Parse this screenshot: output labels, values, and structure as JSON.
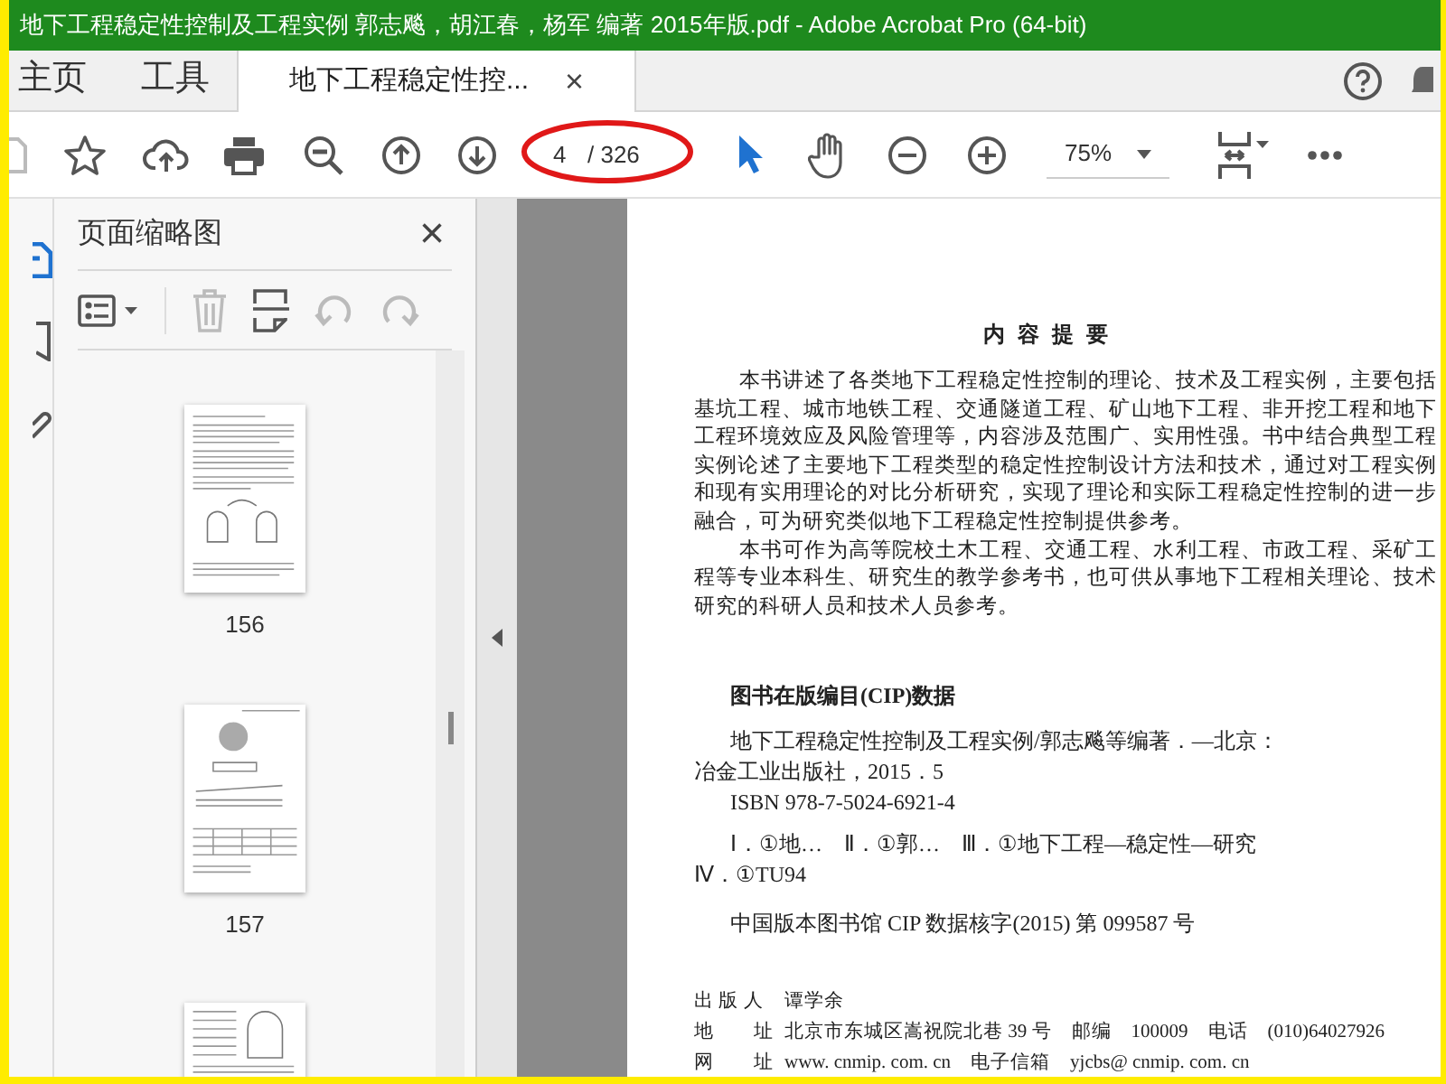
{
  "window": {
    "title": "地下工程稳定性控制及工程实例 郭志飚，胡江春，杨军 编著 2015年版.pdf - Adobe Acrobat Pro (64-bit)"
  },
  "tabs": [
    {
      "label": "主页",
      "selected": false
    },
    {
      "label": "工具",
      "selected": false
    },
    {
      "label": "地下工程稳定性控...",
      "selected": true,
      "close": "×"
    }
  ],
  "toolbar": {
    "page_value": "4",
    "page_total": "/ 326",
    "zoom": "75%"
  },
  "sidebar": {
    "title": "页面缩略图",
    "close": "×",
    "thumbnails": [
      {
        "label": "156",
        "kind": "text"
      },
      {
        "label": "157",
        "kind": "figure"
      },
      {
        "kind": "arch"
      }
    ]
  },
  "document": {
    "heading": "内 容 提 要",
    "summary": [
      {
        "text": "本书讲述了各类地下工程稳定性控制的理论、技术及工程实例，主要包括",
        "kind": "first"
      },
      {
        "text": "基坑工程、城市地铁工程、交通隧道工程、矿山地下工程、非开挖工程和地下",
        "kind": "full"
      },
      {
        "text": "工程环境效应及风险管理等，内容涉及范围广、实用性强。书中结合典型工程",
        "kind": "full"
      },
      {
        "text": "实例论述了主要地下工程类型的稳定性控制设计方法和技术，通过对工程实例",
        "kind": "full"
      },
      {
        "text": "和现有实用理论的对比分析研究，实现了理论和实际工程稳定性控制的进一步",
        "kind": "full"
      },
      {
        "text": "融合，可为研究类似地下工程稳定性控制提供参考。",
        "kind": "last"
      },
      {
        "text": "本书可作为高等院校土木工程、交通工程、水利工程、市政工程、采矿工",
        "kind": "first"
      },
      {
        "text": "程等专业本科生、研究生的教学参考书，也可供从事地下工程相关理论、技术",
        "kind": "full"
      },
      {
        "text": "研究的科研人员和技术人员参考。",
        "kind": "last"
      }
    ],
    "cip_heading": "图书在版编目(CIP)数据",
    "cip": [
      {
        "text": "地下工程稳定性控制及工程实例/郭志飚等编著．—北京：",
        "kind": "indent"
      },
      {
        "text": "冶金工业出版社，2015．5",
        "kind": "plain"
      },
      {
        "text": "ISBN 978-7-5024-6921-4",
        "kind": "indent"
      },
      {
        "text": "Ⅰ．①地…　Ⅱ．①郭…　Ⅲ．①地下工程—稳定性—研究",
        "kind": "gap"
      },
      {
        "text": "Ⅳ．①TU94",
        "kind": "plain"
      },
      {
        "text": "中国版本图书馆 CIP 数据核字(2015) 第 099587 号",
        "kind": "gap"
      }
    ],
    "imprint": [
      {
        "label": "出 版 人",
        "value": "谭学余"
      },
      {
        "label": "地　　址",
        "value": "北京市东城区嵩祝院北巷 39 号　邮编　100009　电话　(010)64027926"
      },
      {
        "label": "网　　址",
        "value": "www. cnmip. com. cn　电子信箱　yjcbs@ cnmip. com. cn"
      }
    ]
  }
}
